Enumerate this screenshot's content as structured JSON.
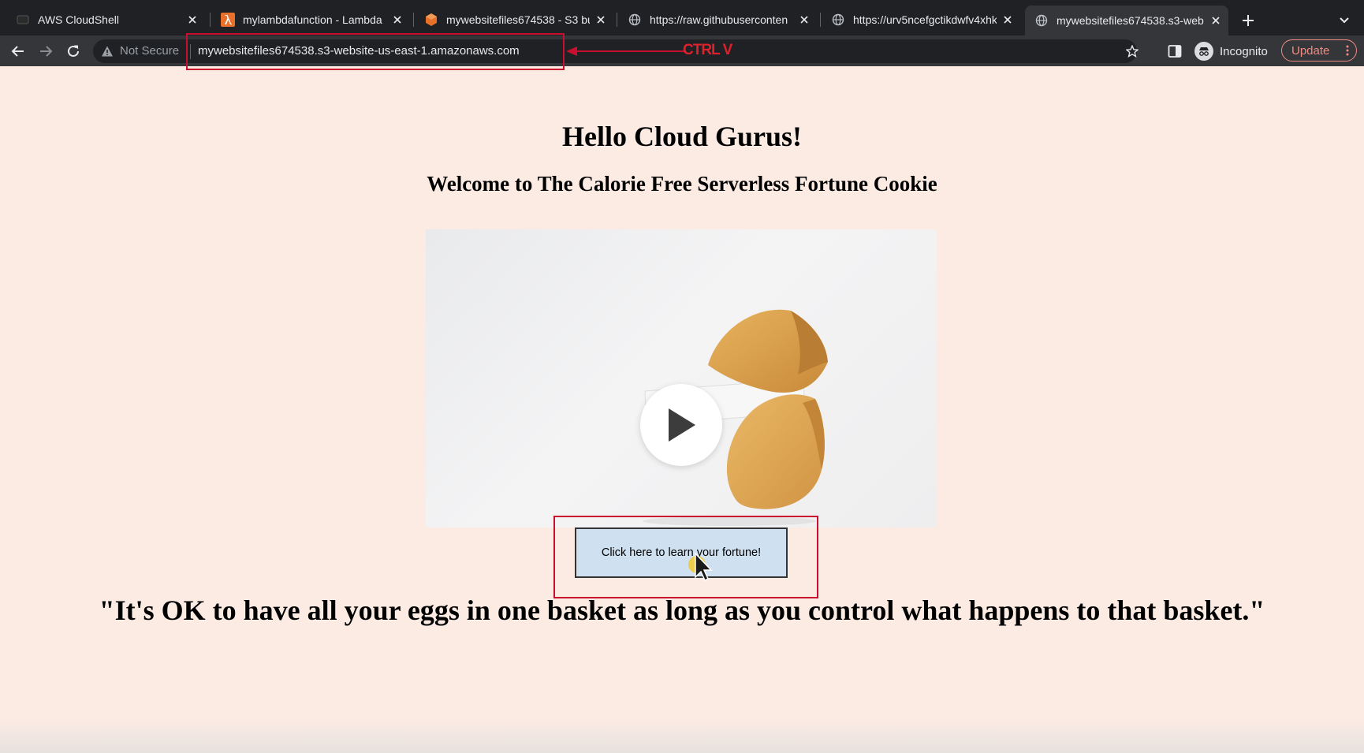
{
  "browser": {
    "tabs": [
      {
        "title": "AWS CloudShell",
        "icon": "cloudshell-icon",
        "active": false
      },
      {
        "title": "mylambdafunction - Lambda",
        "icon": "lambda-icon",
        "active": false
      },
      {
        "title": "mywebsitefiles674538 - S3 bu",
        "icon": "s3-bucket-icon",
        "active": false
      },
      {
        "title": "https://raw.githubuserconten",
        "icon": "globe-icon",
        "active": false
      },
      {
        "title": "https://urv5ncefgctikdwfv4xhk",
        "icon": "globe-icon",
        "active": false
      },
      {
        "title": "mywebsitefiles674538.s3-web",
        "icon": "globe-icon",
        "active": true
      }
    ],
    "security_label": "Not Secure",
    "url": "mywebsitefiles674538.s3-website-us-east-1.amazonaws.com",
    "profile_label": "Incognito",
    "update_label": "Update"
  },
  "annotation": {
    "label": "CTRL V",
    "color": "#c8102e"
  },
  "page": {
    "heading": "Hello Cloud Gurus!",
    "subheading": "Welcome to The Calorie Free Serverless Fortune Cookie",
    "button_label": "Click here to learn your fortune!",
    "quote": "\"It's OK to have all your eggs in one basket as long as you control what happens to that basket.\""
  },
  "colors": {
    "page_background": "#fcebe3",
    "button_background": "#cfe0f1",
    "tabbar": "#202124",
    "toolbar": "#35363a"
  }
}
